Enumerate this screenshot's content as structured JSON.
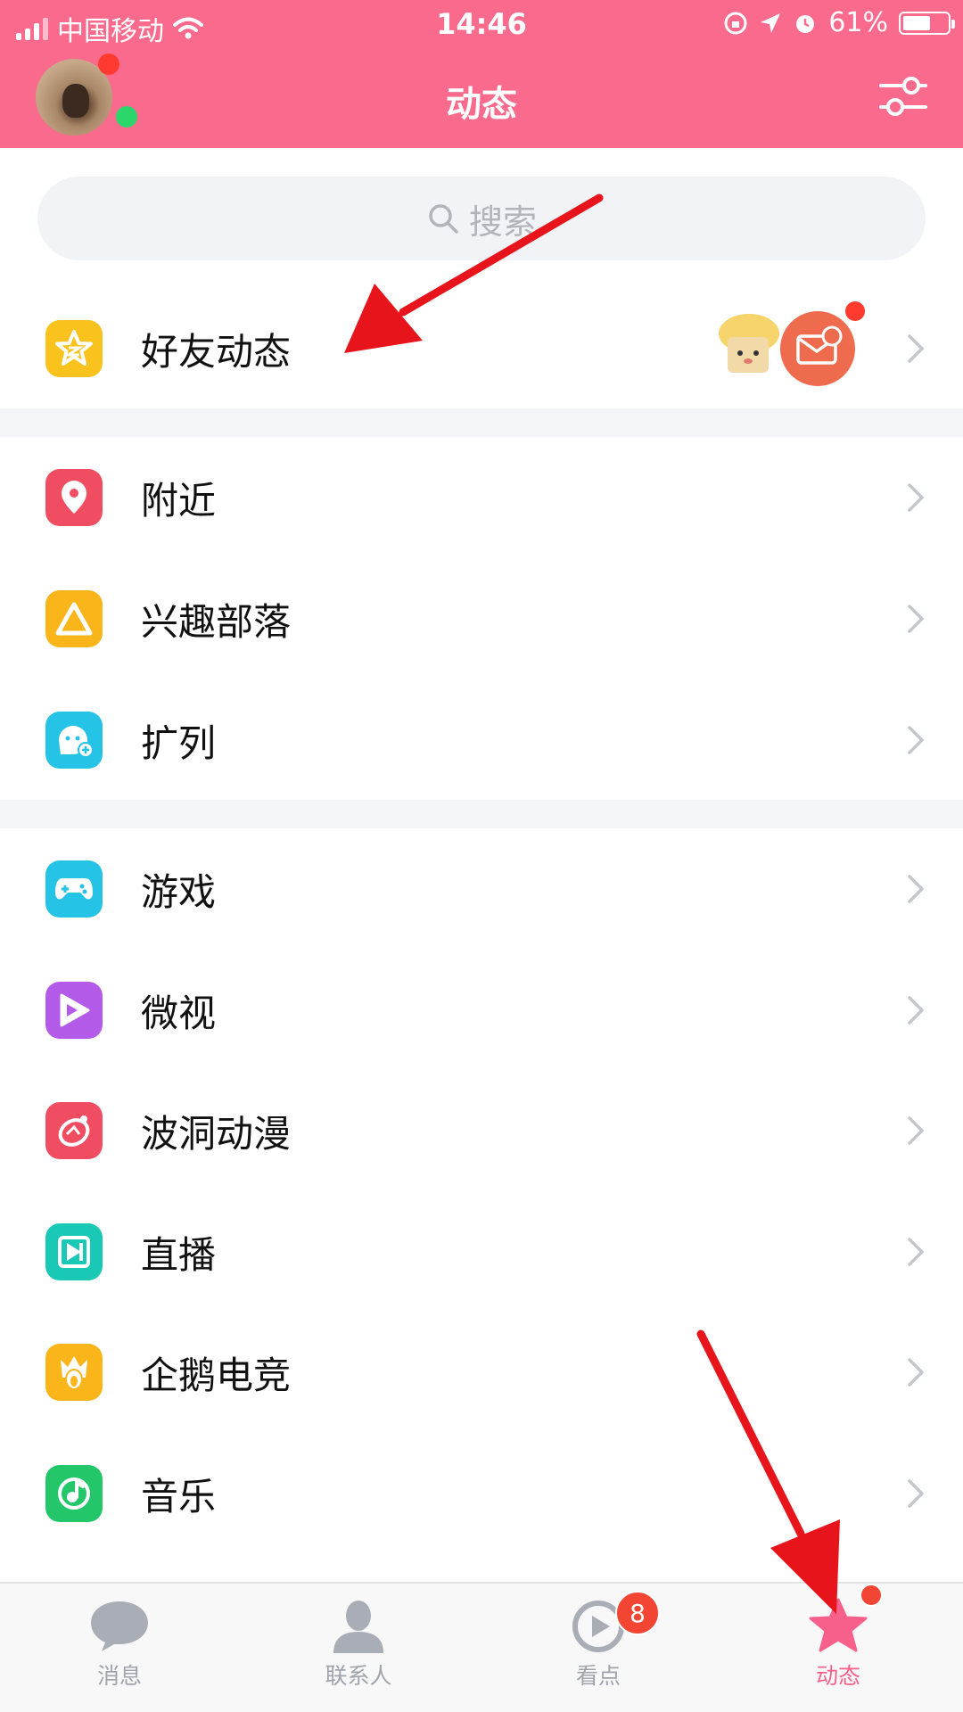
{
  "status_bar": {
    "carrier": "中国移动",
    "time": "14:46",
    "battery": "61%"
  },
  "header": {
    "title": "动态",
    "filter_icon": "sliders-icon"
  },
  "search": {
    "placeholder": "搜索",
    "icon": "search-icon"
  },
  "sections": [
    [
      {
        "label": "好友动态",
        "icon": "star-icon",
        "color": "#f9c21c"
      }
    ],
    [
      {
        "label": "附近",
        "icon": "location-pin-icon",
        "color": "#f14d62"
      },
      {
        "label": "兴趣部落",
        "icon": "tent-icon",
        "color": "#f9b51a"
      },
      {
        "label": "扩列",
        "icon": "face-plus-icon",
        "color": "#25c4e6"
      }
    ],
    [
      {
        "label": "游戏",
        "icon": "gamepad-icon",
        "color": "#25c4e6"
      },
      {
        "label": "微视",
        "icon": "play-icon",
        "color": "#b45ae8"
      },
      {
        "label": "波洞动漫",
        "icon": "comic-icon",
        "color": "#f14d62"
      },
      {
        "label": "直播",
        "icon": "live-icon",
        "color": "#19c8b5"
      },
      {
        "label": "企鹅电竞",
        "icon": "esports-icon",
        "color": "#f9b51a"
      },
      {
        "label": "音乐",
        "icon": "music-icon",
        "color": "#23c76a"
      }
    ]
  ],
  "tabbar": {
    "items": [
      {
        "label": "消息",
        "icon": "chat-bubble-icon"
      },
      {
        "label": "联系人",
        "icon": "person-icon"
      },
      {
        "label": "看点",
        "icon": "video-play-icon",
        "badge": "8"
      },
      {
        "label": "动态",
        "icon": "star-icon",
        "active": true
      }
    ]
  },
  "colors": {
    "accent": "#fa6a8c",
    "badge": "#f24533",
    "annotation": "#e8141c"
  }
}
